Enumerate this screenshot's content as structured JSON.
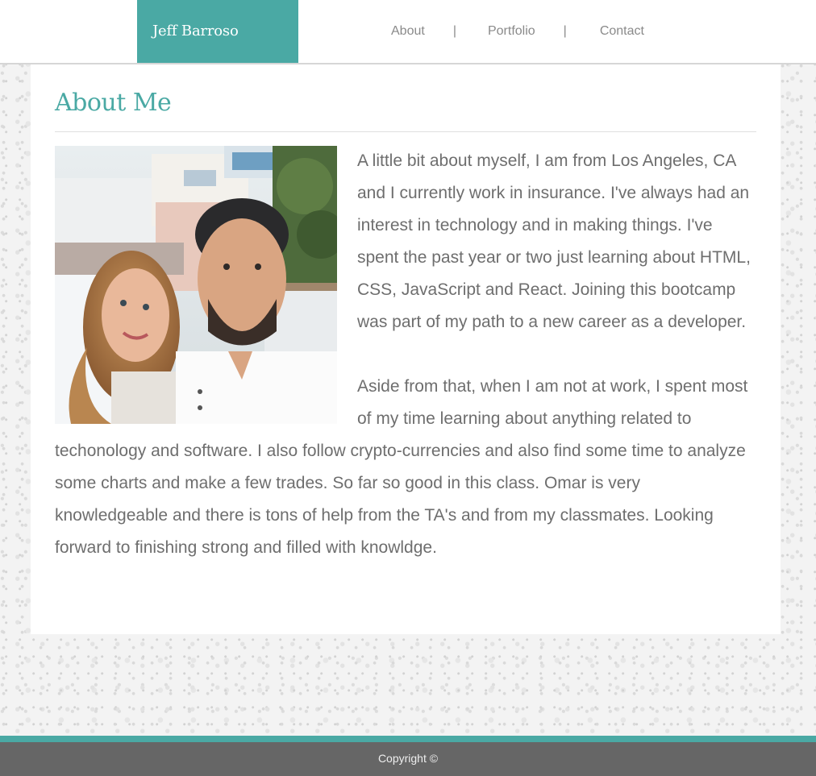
{
  "header": {
    "brand": "Jeff Barroso",
    "nav": [
      {
        "label": "About"
      },
      {
        "label": "Portfolio"
      },
      {
        "label": "Contact"
      }
    ],
    "separator": "|"
  },
  "main": {
    "title": "About Me",
    "photo_alt": "Photo of Jeff Barroso and partner",
    "paragraphs": [
      "A little bit about myself, I am from Los Angeles, CA and I currently work in insurance. I've always had an interest in technology and in making things. I've spent the past year or two just learning about HTML, CSS, JavaScript and React. Joining this bootcamp was part of my path to a new career as a developer.",
      "Aside from that, when I am not at work, I spent most of my time learning about anything related to techonology and software. I also follow crypto-currencies and also find some time to analyze some charts and make a few trades. So far so good in this class. Omar is very knowledgeable and there is tons of help from the TA's and from my classmates. Looking forward to finishing strong and filled with knowldge."
    ]
  },
  "footer": {
    "text": "Copyright ©"
  },
  "colors": {
    "accent": "#4aa9a4",
    "footer_bg": "#666666",
    "text": "#6e6e6e",
    "nav_text": "#8a8a8a"
  }
}
